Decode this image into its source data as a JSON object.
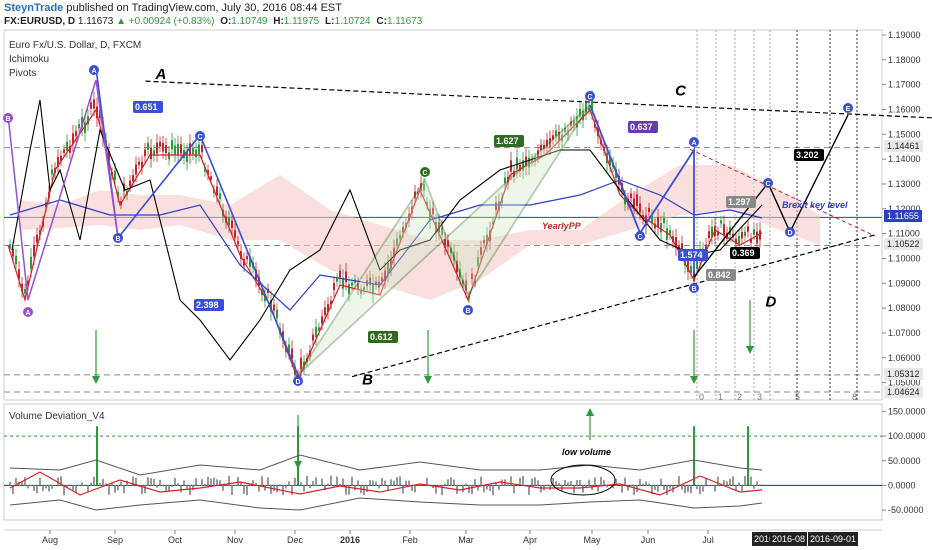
{
  "header": {
    "publisher": "SteynTrade",
    "published_text": "published on TradingView.com, July 30, 2016 08:44 EST",
    "symbol": "FX:EURUSD, D",
    "last": "1.11673",
    "change": "+0.00924 (+0.83%)",
    "open_label": "O:",
    "open": "1.10749",
    "high_label": "H:",
    "high": "1.11975",
    "low_label": "L:",
    "low": "1.10724",
    "close_label": "C:",
    "close": "1.11673"
  },
  "legend": {
    "title": "Euro Fx/U.S. Dollar, D, FXCM",
    "ichimoku": "Ichimoku",
    "pivots": "Pivots",
    "volume_indicator": "Volume Deviation_V4"
  },
  "price_tags": [
    {
      "label": "1.14461",
      "style": "gray"
    },
    {
      "label": "1.11655",
      "style": "blue"
    },
    {
      "label": "1.10522",
      "style": "gray"
    },
    {
      "label": "1.05312",
      "style": "gray"
    },
    {
      "label": "1.04624",
      "style": "gray"
    }
  ],
  "date_tags": [
    "2016-0",
    "2016-08",
    "2016-09-01"
  ],
  "chart_data": [
    {
      "type": "candlestick",
      "title": "Euro Fx/U.S. Dollar, D, FXCM",
      "x_ticks": [
        "Aug",
        "Sep",
        "Oct",
        "Nov",
        "Dec",
        "2016",
        "Feb",
        "Mar",
        "Apr",
        "May",
        "Jun",
        "Jul"
      ],
      "y_ticks": [
        "1.19000",
        "1.18000",
        "1.17000",
        "1.16000",
        "1.15000",
        "1.14000",
        "1.13000",
        "1.12000",
        "1.11000",
        "1.10000",
        "1.09000",
        "1.08000",
        "1.07000",
        "1.06000",
        "1.05000"
      ],
      "ylim": [
        1.043,
        1.192
      ],
      "colors": {
        "up": "#2e9b3a",
        "down": "#c0272d",
        "wave": "#000000",
        "tenkan": "#d6212b",
        "kijun": "#2d3fc7",
        "pattern_abc": "#9b4fd6",
        "pattern_green": "#2f6b1f"
      },
      "elliott_points": [
        {
          "label": "A",
          "date": "2015-08-24",
          "price": 1.1714
        },
        {
          "label": "B",
          "date": "2015-12-03",
          "price": 1.0524
        },
        {
          "label": "C",
          "date": "2016-05-03",
          "price": 1.1616
        },
        {
          "label": "D",
          "date": "2016-06-24",
          "price": 1.0912
        },
        {
          "label": "E",
          "date": "2016-09-15",
          "price": 1.1565
        }
      ],
      "annotations": [
        {
          "text": "0.651"
        },
        {
          "text": "2.398"
        },
        {
          "text": "0.612"
        },
        {
          "text": "1.627"
        },
        {
          "text": "0.637"
        },
        {
          "text": "1.574"
        },
        {
          "text": "0.842"
        },
        {
          "text": "1.297"
        },
        {
          "text": "0.369"
        },
        {
          "text": "3.202"
        },
        {
          "text": "YearlyPP"
        },
        {
          "text": "Brexit key level"
        }
      ],
      "harmonic_letters": [
        "A",
        "B",
        "C",
        "D",
        "C",
        "B",
        "C",
        "A",
        "B",
        "C",
        "A",
        "B",
        "C",
        "D",
        "E"
      ],
      "fib_time_labels": [
        "0",
        "1",
        "2",
        "3",
        "5",
        "8"
      ]
    },
    {
      "type": "bar",
      "title": "Volume Deviation_V4",
      "y_ticks": [
        "150.0000",
        "100.0000",
        "50.0000",
        "0.0000",
        "-50.0000"
      ],
      "ylim": [
        -70,
        165
      ],
      "annotations": [
        {
          "text": "low volume"
        }
      ]
    }
  ]
}
